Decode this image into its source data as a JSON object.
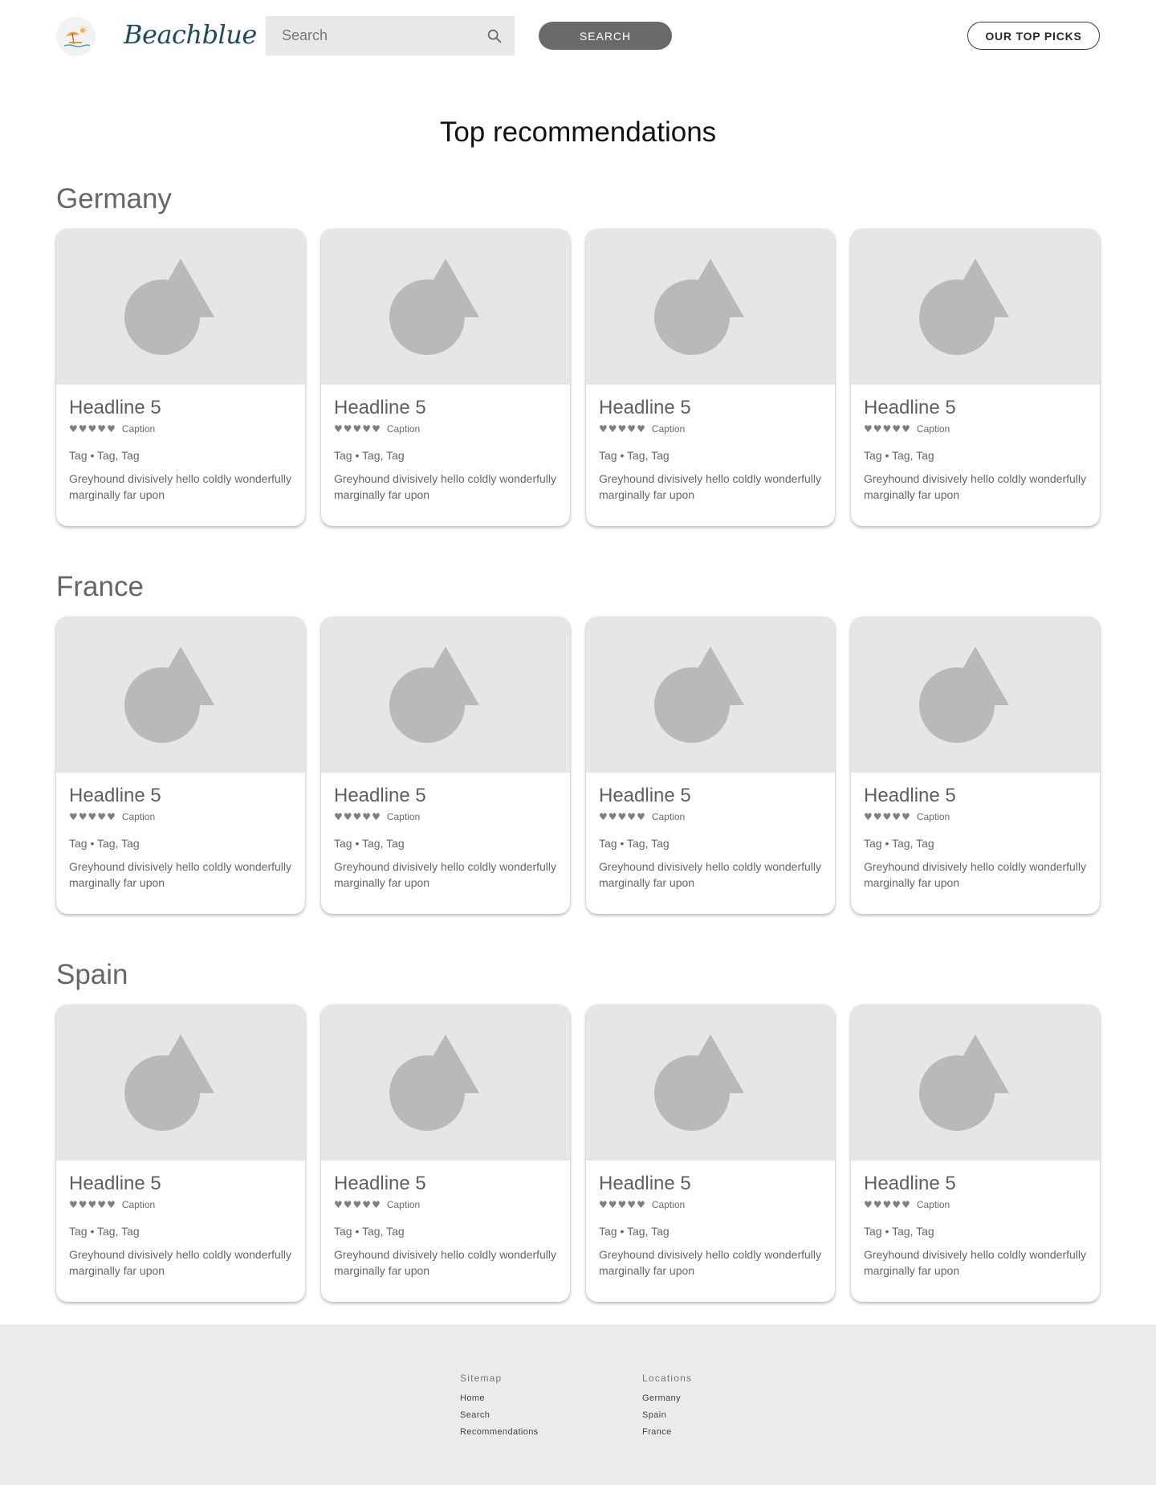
{
  "header": {
    "brand": "Beachblue",
    "search_placeholder": "Search",
    "search_button": "SEARCH",
    "top_picks_button": "OUR TOP PICKS"
  },
  "main": {
    "title": "Top recommendations",
    "sections": [
      {
        "title": "Germany",
        "cards": [
          {
            "headline": "Headline 5",
            "rating": "5 of 5",
            "caption": "Caption",
            "tags": "Tag • Tag, Tag",
            "description": "Greyhound divisively hello coldly wonderfully marginally far upon"
          },
          {
            "headline": "Headline 5",
            "rating": "5 of 5",
            "caption": "Caption",
            "tags": "Tag • Tag, Tag",
            "description": "Greyhound divisively hello coldly wonderfully marginally far upon"
          },
          {
            "headline": "Headline 5",
            "rating": "5 of 5",
            "caption": "Caption",
            "tags": "Tag • Tag, Tag",
            "description": "Greyhound divisively hello coldly wonderfully marginally far upon"
          },
          {
            "headline": "Headline 5",
            "rating": "5 of 5",
            "caption": "Caption",
            "tags": "Tag • Tag, Tag",
            "description": "Greyhound divisively hello coldly wonderfully marginally far upon"
          }
        ]
      },
      {
        "title": "France",
        "cards": [
          {
            "headline": "Headline 5",
            "rating": "5 of 5",
            "caption": "Caption",
            "tags": "Tag • Tag, Tag",
            "description": "Greyhound divisively hello coldly wonderfully marginally far upon"
          },
          {
            "headline": "Headline 5",
            "rating": "5 of 5",
            "caption": "Caption",
            "tags": "Tag • Tag, Tag",
            "description": "Greyhound divisively hello coldly wonderfully marginally far upon"
          },
          {
            "headline": "Headline 5",
            "rating": "5 of 5",
            "caption": "Caption",
            "tags": "Tag • Tag, Tag",
            "description": "Greyhound divisively hello coldly wonderfully marginally far upon"
          },
          {
            "headline": "Headline 5",
            "rating": "5 of 5",
            "caption": "Caption",
            "tags": "Tag • Tag, Tag",
            "description": "Greyhound divisively hello coldly wonderfully marginally far upon"
          }
        ]
      },
      {
        "title": "Spain",
        "cards": [
          {
            "headline": "Headline 5",
            "rating": "5 of 5",
            "caption": "Caption",
            "tags": "Tag • Tag, Tag",
            "description": "Greyhound divisively hello coldly wonderfully marginally far upon"
          },
          {
            "headline": "Headline 5",
            "rating": "5 of 5",
            "caption": "Caption",
            "tags": "Tag • Tag, Tag",
            "description": "Greyhound divisively hello coldly wonderfully marginally far upon"
          },
          {
            "headline": "Headline 5",
            "rating": "5 of 5",
            "caption": "Caption",
            "tags": "Tag • Tag, Tag",
            "description": "Greyhound divisively hello coldly wonderfully marginally far upon"
          },
          {
            "headline": "Headline 5",
            "rating": "5 of 5",
            "caption": "Caption",
            "tags": "Tag • Tag, Tag",
            "description": "Greyhound divisively hello coldly wonderfully marginally far upon"
          }
        ]
      }
    ]
  },
  "footer": {
    "sitemap": {
      "heading": "Sitemap",
      "links": [
        "Home",
        "Search",
        "Recommendations"
      ]
    },
    "locations": {
      "heading": "Locations",
      "links": [
        "Germany",
        "Spain",
        "France"
      ]
    }
  },
  "icons": {
    "logo": "beach-umbrella-icon",
    "search": "magnifier-icon",
    "card_media": "image-placeholder-icon",
    "rating": "heart-icon"
  },
  "colors": {
    "brand": "#1d4a5e",
    "search_button_bg": "#6a6a6a",
    "footer_bg": "#ebebeb",
    "placeholder_bg": "#e6e6e6",
    "placeholder_shape": "#b9b9b9"
  }
}
